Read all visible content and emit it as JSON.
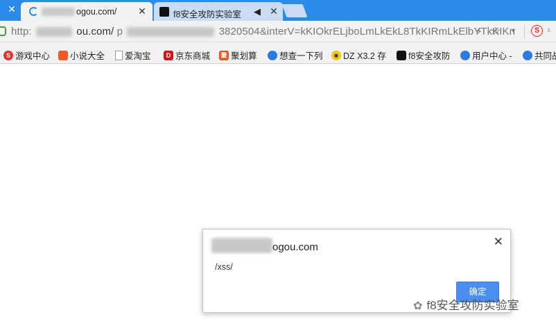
{
  "tabs": [
    {
      "title_visible": "ogou.com/",
      "close": "✕"
    },
    {
      "title": "f8安全攻防实验室",
      "close": "✕"
    }
  ],
  "first_tab_close": "✕",
  "address": {
    "scheme": "http:",
    "host_suffix": "ou.com/",
    "path_prefix": "p",
    "query": "3820504&interV=kKIOkrELjboLmLkEkL8TkKIRmLkElbYTkKIKn"
  },
  "bookmarks": [
    {
      "label": "游戏中心",
      "icon": "sogou-game-icon",
      "color": "#e03030"
    },
    {
      "label": "小说大全",
      "icon": "novel-icon",
      "color": "#f05a28"
    },
    {
      "label": "爱淘宝",
      "icon": "page-icon",
      "color": "#999999"
    },
    {
      "label": "京东商城",
      "icon": "jd-icon",
      "color": "#d0161b"
    },
    {
      "label": "聚划算",
      "icon": "juhuasuan-icon",
      "color": "#e8541e"
    },
    {
      "label": "想查一下列",
      "icon": "globe-icon",
      "color": "#2a7be4"
    },
    {
      "label": "DZ X3.2 存",
      "icon": "dz-icon",
      "color": "#333333"
    },
    {
      "label": "f8安全攻防",
      "icon": "f8-icon",
      "color": "#111111"
    },
    {
      "label": "用户中心 -",
      "icon": "user-center-icon",
      "color": "#2a7be4"
    },
    {
      "label": "共同战",
      "icon": "user-center-icon",
      "color": "#2a7be4"
    }
  ],
  "dialog": {
    "title_visible": "ogou.com",
    "message": "/xss/",
    "ok_label": "确定",
    "close": "✕"
  },
  "watermark": "f8安全攻防实验室"
}
